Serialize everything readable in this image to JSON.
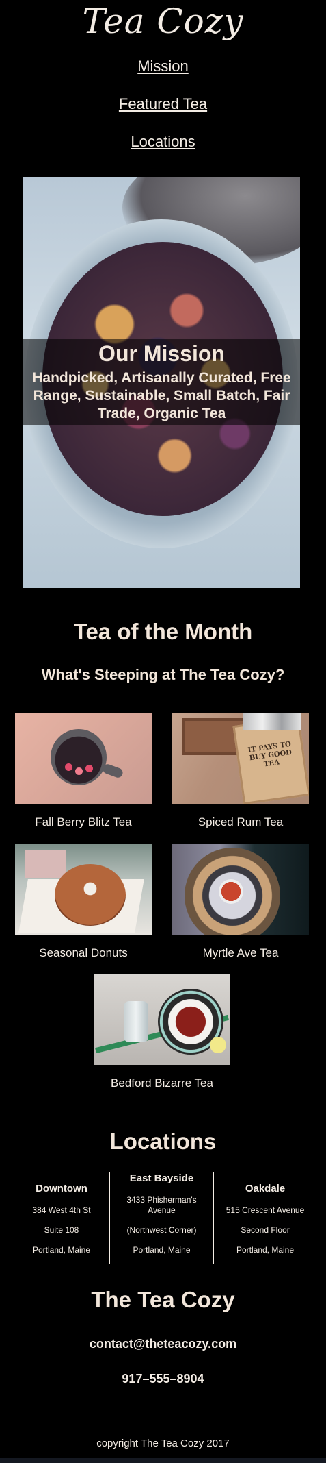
{
  "brand": {
    "logo_text": "Tea Cozy"
  },
  "nav": [
    "Mission",
    "Featured Tea",
    "Locations"
  ],
  "mission": {
    "heading": "Our Mission",
    "text": "Handpicked, Artisanally Curated, Free Range, Sustainable, Small Batch, Fair Trade, Organic Tea"
  },
  "tea_of_month": {
    "heading": "Tea of the Month",
    "subheading": "What's Steeping at The Tea Cozy?",
    "teas": [
      {
        "name": "Fall Berry Blitz Tea"
      },
      {
        "name": "Spiced Rum Tea",
        "box_text": "IT PAYS TO BUY GOOD TEA"
      },
      {
        "name": "Seasonal Donuts"
      },
      {
        "name": "Myrtle Ave Tea"
      },
      {
        "name": "Bedford Bizarre Tea"
      }
    ]
  },
  "locations": {
    "heading": "Locations",
    "items": [
      {
        "name": "Downtown",
        "lines": [
          "384 West 4th St",
          "Suite 108",
          "Portland, Maine"
        ]
      },
      {
        "name": "East Bayside",
        "lines": [
          "3433 Phisherman's Avenue",
          "(Northwest Corner)",
          "Portland, Maine"
        ]
      },
      {
        "name": "Oakdale",
        "lines": [
          "515 Crescent Avenue",
          "Second Floor",
          "Portland, Maine"
        ]
      }
    ]
  },
  "footer": {
    "heading": "The Tea Cozy",
    "email": "contact@theteacozy.com",
    "phone": "917–555–8904",
    "copyright": "copyright The Tea Cozy 2017"
  },
  "colors": {
    "background": "#000000",
    "text": "#f2e6da"
  }
}
